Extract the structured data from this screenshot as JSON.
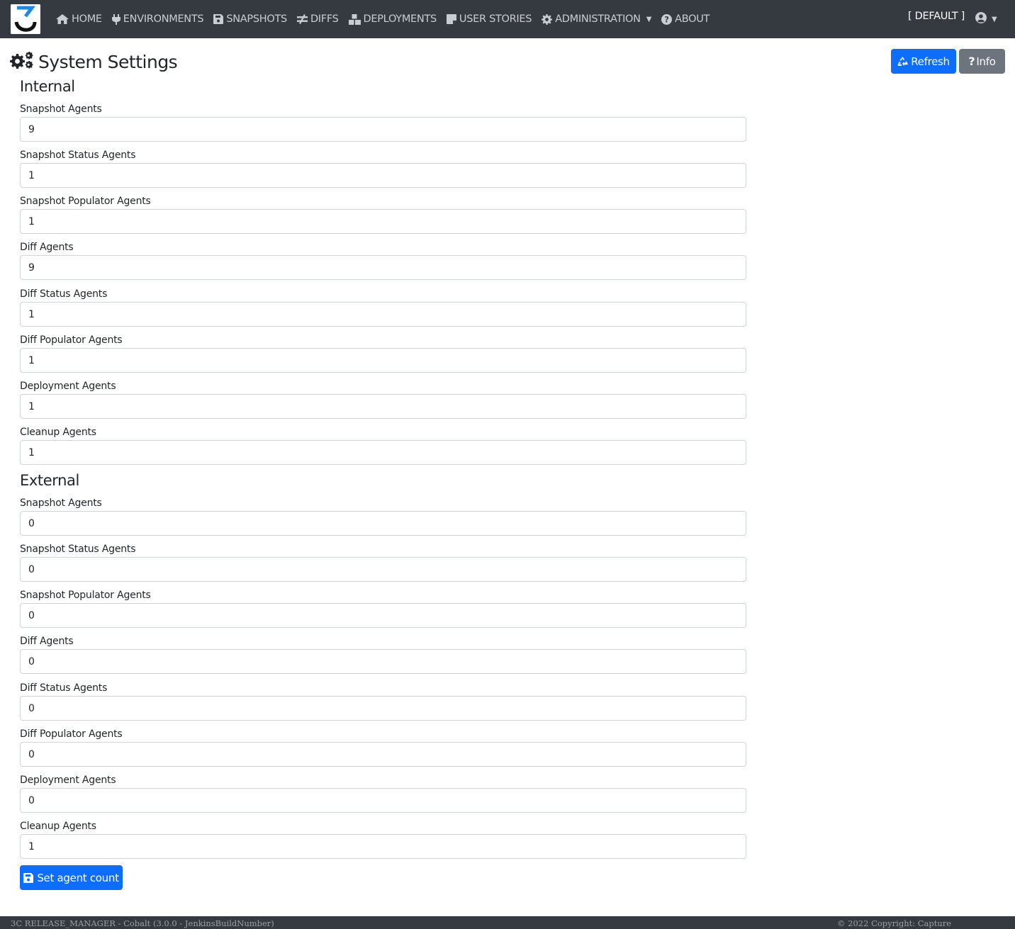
{
  "nav": {
    "items": [
      {
        "label": "HOME",
        "icon": "home-icon"
      },
      {
        "label": "ENVIRONMENTS",
        "icon": "plug-icon"
      },
      {
        "label": "SNAPSHOTS",
        "icon": "save-icon"
      },
      {
        "label": "DIFFS",
        "icon": "not-equal-icon"
      },
      {
        "label": "DEPLOYMENTS",
        "icon": "boxes-icon"
      },
      {
        "label": "USER STORIES",
        "icon": "sticky-note-icon"
      },
      {
        "label": "ADMINISTRATION",
        "icon": "cog-icon"
      },
      {
        "label": "ABOUT",
        "icon": "question-circle-icon"
      }
    ],
    "environment": "[ DEFAULT ]",
    "user_icon": "user-circle-icon"
  },
  "page": {
    "title": "System Settings",
    "refresh_label": "Refresh",
    "info_label": "Info"
  },
  "internal": {
    "title": "Internal",
    "fields": [
      {
        "label": "Snapshot Agents",
        "value": "9"
      },
      {
        "label": "Snapshot Status Agents",
        "value": "1"
      },
      {
        "label": "Snapshot Populator Agents",
        "value": "1"
      },
      {
        "label": "Diff Agents",
        "value": "9"
      },
      {
        "label": "Diff Status Agents",
        "value": "1"
      },
      {
        "label": "Diff Populator Agents",
        "value": "1"
      },
      {
        "label": "Deployment Agents",
        "value": "1"
      },
      {
        "label": "Cleanup Agents",
        "value": "1"
      }
    ]
  },
  "external": {
    "title": "External",
    "fields": [
      {
        "label": "Snapshot Agents",
        "value": "0"
      },
      {
        "label": "Snapshot Status Agents",
        "value": "0"
      },
      {
        "label": "Snapshot Populator Agents",
        "value": "0"
      },
      {
        "label": "Diff Agents",
        "value": "0"
      },
      {
        "label": "Diff Status Agents",
        "value": "0"
      },
      {
        "label": "Diff Populator Agents",
        "value": "0"
      },
      {
        "label": "Deployment Agents",
        "value": "0"
      },
      {
        "label": "Cleanup Agents",
        "value": "1"
      }
    ]
  },
  "submit_label": "Set agent count",
  "footer": {
    "left": "3C RELEASE_MANAGER - Cobalt (3.0.0 - JenkinsBuildNumber)",
    "right": "© 2022 Copyright: Capture"
  },
  "colors": {
    "navbar": "#343a40",
    "primary": "#0d6efd",
    "secondary": "#6c757d"
  }
}
